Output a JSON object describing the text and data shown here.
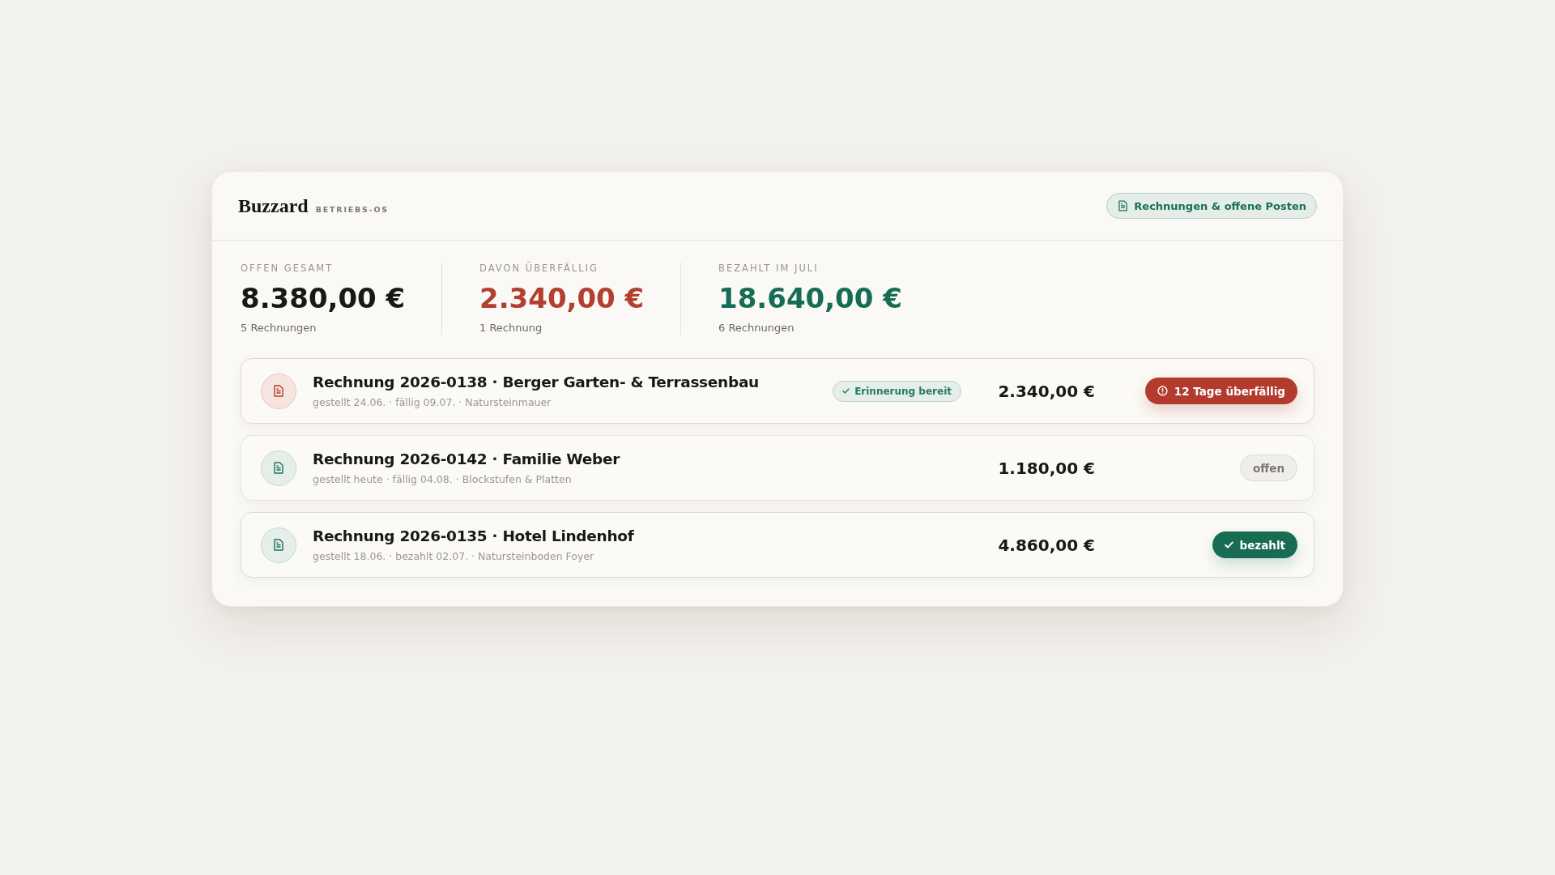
{
  "app": {
    "name": "Buzzard",
    "tagline": "BETRIEBS-OS"
  },
  "header_button": {
    "label": "Rechnungen & offene Posten"
  },
  "stats": [
    {
      "kind": "neutral",
      "label": "OFFEN GESAMT",
      "value": "8.380,00 €",
      "note": "5 Rechnungen"
    },
    {
      "kind": "overdue",
      "label": "DAVON ÜBERFÄLLIG",
      "value": "2.340,00 €",
      "note": "1 Rechnung"
    },
    {
      "kind": "paid",
      "label": "BEZAHLT IM JULI",
      "value": "18.640,00 €",
      "note": "6 Rechnungen"
    }
  ],
  "invoices": [
    {
      "title": "Rechnung 2026-0138 · Berger Garten- & Terrassenbau",
      "details": "gestellt 24.06. · fällig 09.07. · Natursteinmauer",
      "reminder": "Erinnerung bereit",
      "amount": "2.340,00 €",
      "status": {
        "kind": "overdue",
        "label": "12 Tage überfällig"
      }
    },
    {
      "title": "Rechnung 2026-0142 · Familie Weber",
      "details": "gestellt heute · fällig 04.08. · Blockstufen & Platten",
      "amount": "1.180,00 €",
      "status": {
        "kind": "open",
        "label": "offen"
      }
    },
    {
      "title": "Rechnung 2026-0135 · Hotel Lindenhof",
      "details": "gestellt 18.06. · bezahlt 02.07. · Natursteinboden Foyer",
      "amount": "4.860,00 €",
      "status": {
        "kind": "paid",
        "label": "bezahlt"
      }
    }
  ]
}
